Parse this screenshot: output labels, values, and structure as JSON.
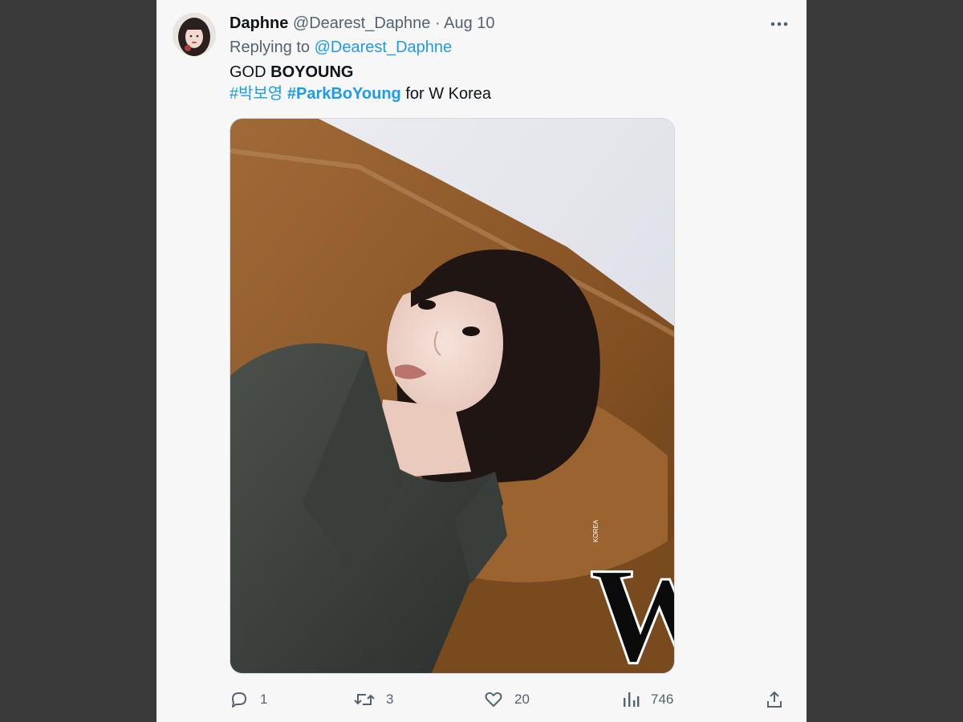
{
  "tweet": {
    "author_name": "Daphne",
    "author_handle": "@Dearest_Daphne",
    "separator": "·",
    "date": "Aug 10",
    "replying_prefix": "Replying to",
    "replying_handle": "@Dearest_Daphne",
    "line1_plain": "GOD",
    "line1_bold": "BOYOUNG",
    "hashtag_korean": "#박보영",
    "hashtag_english": "#ParkBoYoung",
    "line2_suffix": "for W Korea",
    "image_logo_text": "W",
    "image_logo_subtext": "KOREA"
  },
  "actions": {
    "reply_count": "1",
    "retweet_count": "3",
    "like_count": "20",
    "views_count": "746"
  },
  "icons": {
    "reply": "reply-icon",
    "retweet": "retweet-icon",
    "like": "heart-icon",
    "views": "views-icon",
    "share": "share-icon",
    "more": "more-icon"
  },
  "colors": {
    "link": "#1d9bf0",
    "secondary_text": "#536471",
    "background": "#f7f7f7"
  }
}
